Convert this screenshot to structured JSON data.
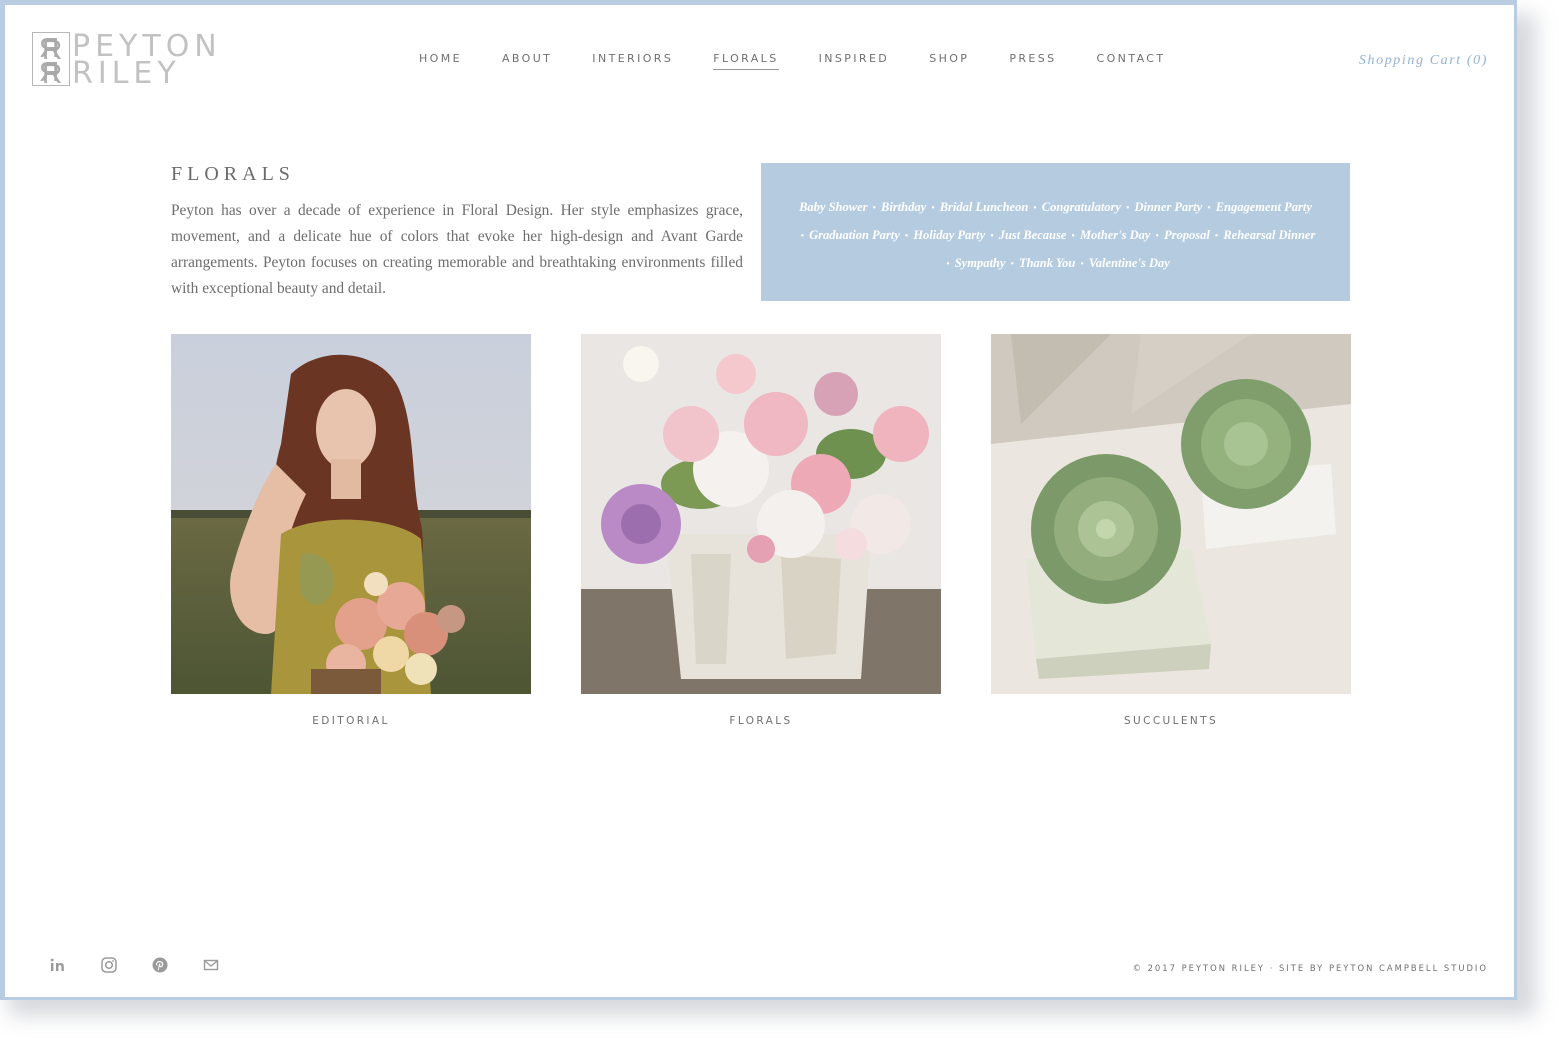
{
  "brand": {
    "logo_line1": "PEYTON",
    "logo_line2": "RILEY"
  },
  "nav": {
    "items": [
      "HOME",
      "ABOUT",
      "INTERIORS",
      "FLORALS",
      "INSPIRED",
      "SHOP",
      "PRESS",
      "CONTACT"
    ],
    "active": "FLORALS",
    "cart_label": "Shopping Cart (0)"
  },
  "intro": {
    "title": "FLORALS",
    "text": "Peyton has over a decade of experience in Floral Design. Her style emphasizes grace, movement, and a delicate hue of colors that evoke her high-design and Avant Garde arrangements. Peyton focuses on creating memorable and breathtaking environments filled with exceptional beauty and detail."
  },
  "occasions": [
    "Baby Shower",
    "Birthday",
    "Bridal Luncheon",
    "Congratulatory",
    "Dinner Party",
    "Engagement Party",
    "Graduation Party",
    "Holiday Party",
    "Just Because",
    "Mother's Day",
    "Proposal",
    "Rehearsal Dinner",
    "Sympathy",
    "Thank You",
    "Valentine's Day"
  ],
  "gallery": [
    {
      "caption": "EDITORIAL"
    },
    {
      "caption": "FLORALS"
    },
    {
      "caption": "SUCCULENTS"
    }
  ],
  "footer": {
    "social_icons": [
      "linkedin-icon",
      "instagram-icon",
      "pinterest-icon",
      "email-icon"
    ],
    "copyright": "© 2017 PEYTON RILEY · SITE BY PEYTON CAMPBELL STUDIO"
  },
  "colors": {
    "accent": "#b5cbe0",
    "cart": "#93b3d3",
    "text": "#6d6d6d",
    "frame": "#b9cde2"
  }
}
